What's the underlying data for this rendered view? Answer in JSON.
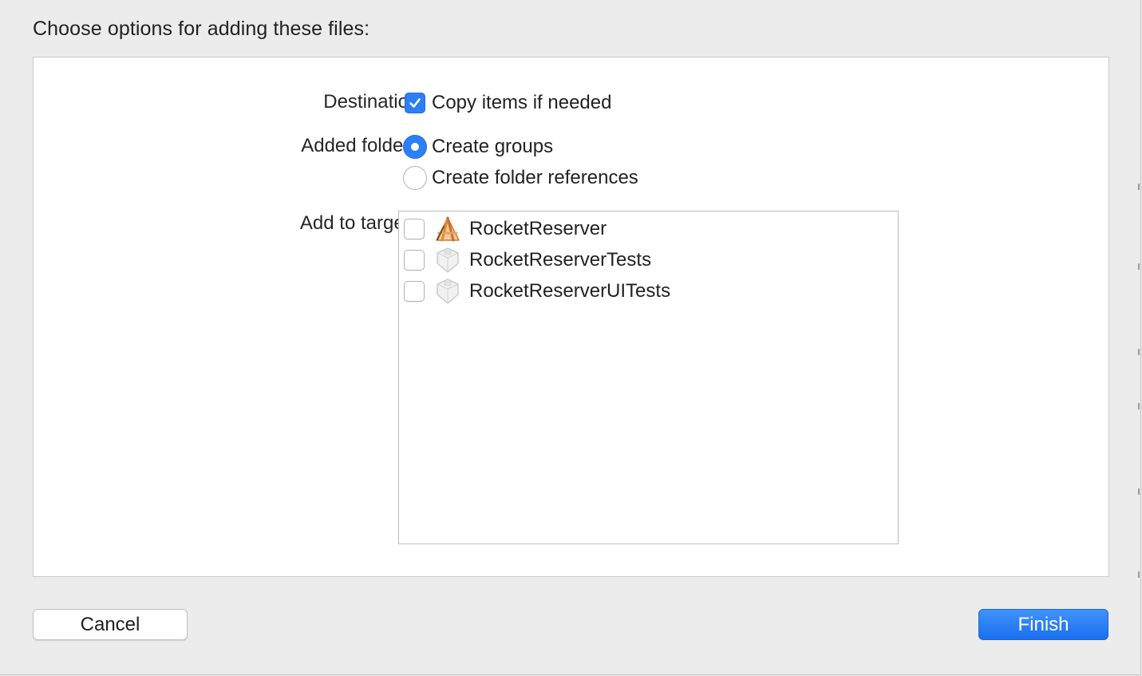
{
  "dialog": {
    "heading": "Choose options for adding these files:"
  },
  "options": {
    "destination_label": "Destination:",
    "copy_items_label": "Copy items if needed",
    "copy_items_checked": true,
    "added_folders_label": "Added folders:",
    "folder_choices": [
      {
        "label": "Create groups",
        "selected": true
      },
      {
        "label": "Create folder references",
        "selected": false
      }
    ],
    "targets_label": "Add to targets:",
    "targets": [
      {
        "name": "RocketReserver",
        "icon": "app-target-icon",
        "checked": false
      },
      {
        "name": "RocketReserverTests",
        "icon": "test-bundle-icon",
        "checked": false
      },
      {
        "name": "RocketReserverUITests",
        "icon": "test-bundle-icon",
        "checked": false
      }
    ]
  },
  "buttons": {
    "cancel_label": "Cancel",
    "finish_label": "Finish"
  },
  "colors": {
    "accent": "#2d7ff6",
    "window_bg": "#ececec",
    "panel_bg": "#ffffff"
  }
}
